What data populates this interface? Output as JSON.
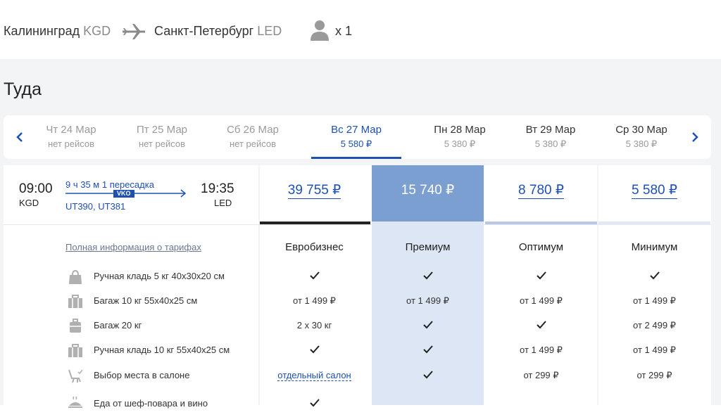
{
  "header": {
    "from_city": "Калининград",
    "from_code": "KGD",
    "to_city": "Санкт-Петербург",
    "to_code": "LED",
    "passengers": "x 1",
    "icons": [
      "plane-icon",
      "person-icon"
    ]
  },
  "direction_title": "Туда",
  "dates": [
    {
      "label": "Чт 24 Мар",
      "sub": "нет рейсов"
    },
    {
      "label": "Пт 25 Мар",
      "sub": "нет рейсов"
    },
    {
      "label": "Сб 26 Мар",
      "sub": "нет рейсов"
    },
    {
      "label": "Вс 27 Мар",
      "sub": "5 580 ₽",
      "active": true
    },
    {
      "label": "Пн 28 Мар",
      "sub": "5 380 ₽"
    },
    {
      "label": "Вт 29 Мар",
      "sub": "5 380 ₽"
    },
    {
      "label": "Ср 30 Мар",
      "sub": "5 380 ₽"
    }
  ],
  "flight": {
    "dep_time": "09:00",
    "dep_code": "KGD",
    "arr_time": "19:35",
    "arr_code": "LED",
    "duration": "9 ч 35 м 1 пересадка",
    "stop_code": "VKO",
    "flight_numbers": "UT390, UT381"
  },
  "fares": {
    "prices": [
      "39 755 ₽",
      "15 740 ₽",
      "8 780 ₽",
      "5 580 ₽"
    ],
    "names": [
      "Евробизнес",
      "Премиум",
      "Оптимум",
      "Минимум"
    ],
    "full_info_link": "Полная информация о тарифах"
  },
  "features": [
    {
      "label": "Ручная кладь 5 кг 40x30x20 см",
      "icon": "handbag-icon",
      "values": [
        "✓",
        "✓",
        "✓",
        "✓"
      ]
    },
    {
      "label": "Багаж 10 кг 55x40x25 см",
      "icon": "suitcase-icon",
      "values": [
        "от 1 499 ₽",
        "от 1 499 ₽",
        "от 1 499 ₽",
        "от 1 499 ₽"
      ]
    },
    {
      "label": "Багаж 20 кг",
      "icon": "luggage-icon",
      "values": [
        "2 х 30 кг",
        "✓",
        "✓",
        "от 2 499 ₽"
      ]
    },
    {
      "label": "Ручная кладь 10 кг 55x40x25 см",
      "icon": "suitcase-icon",
      "values": [
        "✓",
        "✓",
        "от 1 499 ₽",
        "от 1 499 ₽"
      ]
    },
    {
      "label": "Выбор места в салоне",
      "icon": "seat-icon",
      "values": [
        "отдельный салон",
        "✓",
        "от 299 ₽",
        "от 299 ₽"
      ]
    },
    {
      "label": "Еда от шеф-повара и вино",
      "icon": "food-icon",
      "values": [
        "✓",
        "",
        "",
        ""
      ]
    }
  ],
  "colors": {
    "accent": "#1e50b4",
    "selected_column": "#dce6f4",
    "selected_price": "#7b9fd0",
    "background": "#f3f4f6"
  }
}
